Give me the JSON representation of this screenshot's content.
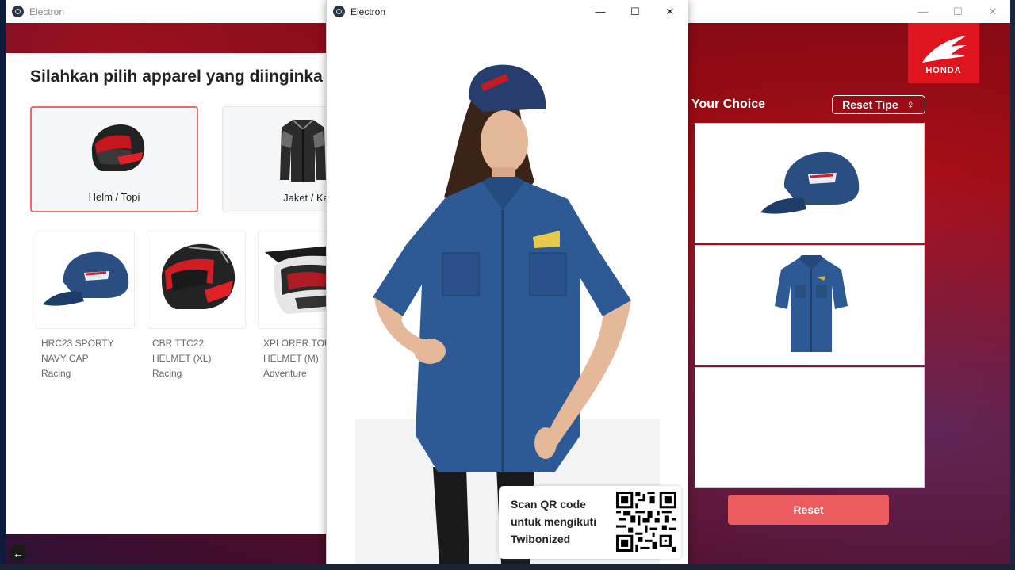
{
  "back_window": {
    "title": "Electron",
    "controls": {
      "minimize": "—",
      "maximize": "☐",
      "close": "✕"
    }
  },
  "front_window": {
    "title": "Electron",
    "controls": {
      "minimize": "—",
      "maximize": "☐",
      "close": "✕"
    }
  },
  "heading": "Silahkan pilih apparel yang diinginka",
  "categories": [
    {
      "label": "Helm / Topi",
      "icon": "helmet-icon",
      "selected": true
    },
    {
      "label": "Jaket / Ka",
      "icon": "jacket-icon",
      "selected": false
    }
  ],
  "products": [
    {
      "line1": "HRC23 SPORTY",
      "line2": "NAVY CAP",
      "line3": "Racing",
      "icon": "cap-icon"
    },
    {
      "line1": "CBR TTC22",
      "line2": "HELMET (XL)",
      "line3": "Racing",
      "icon": "helmet-icon"
    },
    {
      "line1": "XPLORER TOU",
      "line2": "HELMET (M)",
      "line3": "Adventure",
      "icon": "adventure-helmet-icon"
    }
  ],
  "choice": {
    "title": "Your Choice",
    "reset_tipe": "Reset Tipe",
    "reset_tipe_icon": "female-icon",
    "slots": [
      "cap-icon",
      "shirt-icon",
      ""
    ],
    "reset": "Reset"
  },
  "brand": {
    "name": "HONDA",
    "color": "#e0141e"
  },
  "qr": {
    "line1": "Scan QR code",
    "line2": "untuk mengikuti",
    "line3": "Twibonized"
  },
  "colors": {
    "accent": "#ec5b5f",
    "selected_border": "#e66b6b",
    "denim": "#2d5a94"
  }
}
